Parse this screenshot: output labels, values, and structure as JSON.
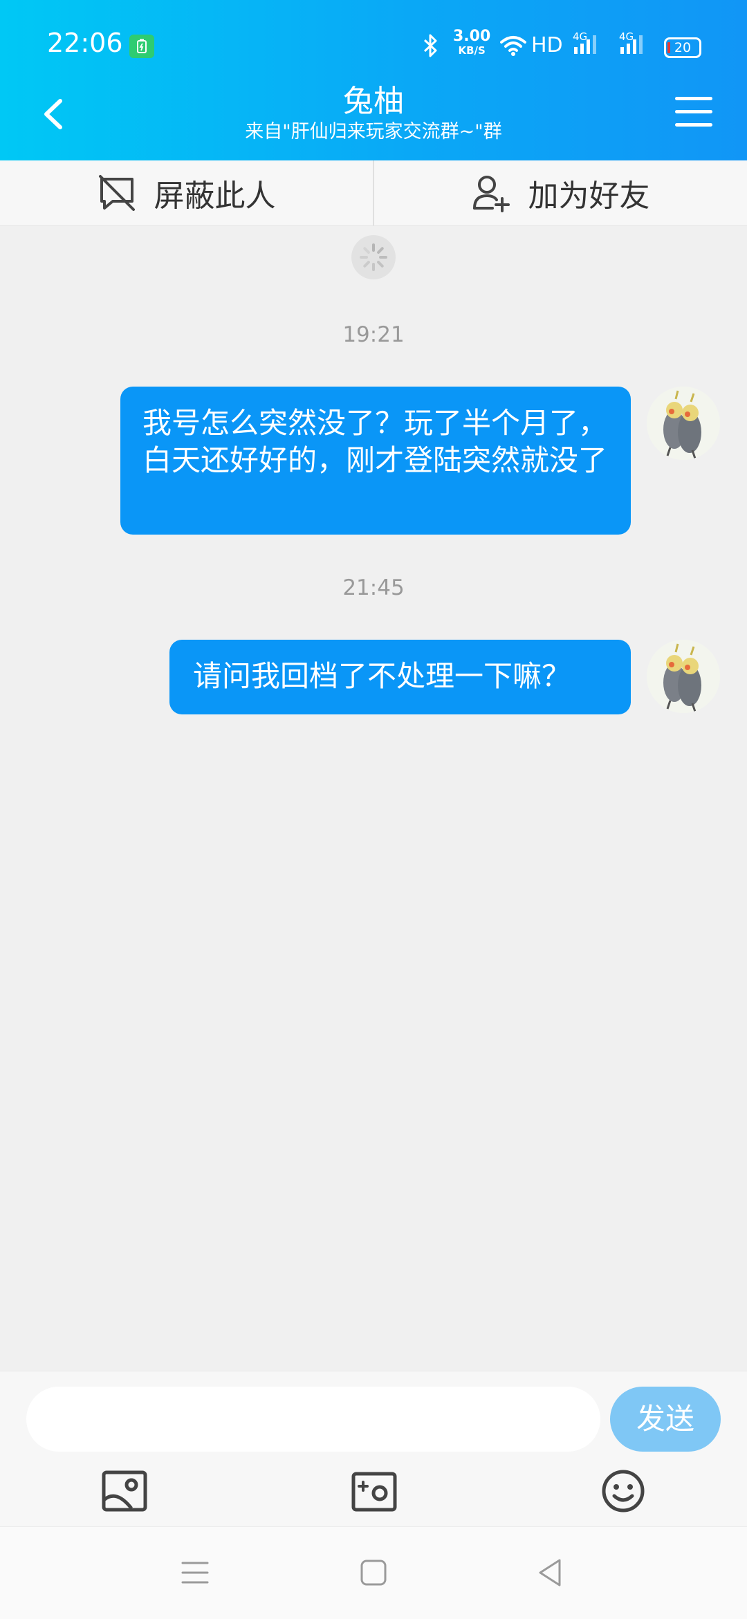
{
  "status_bar": {
    "time": "22:06",
    "net_speed_value": "3.00",
    "net_speed_unit": "KB/S",
    "hd_label": "HD",
    "signal_1": "4G",
    "signal_2": "4G",
    "battery_level": "20"
  },
  "header": {
    "title": "兔柚",
    "subtitle": "来自\"肝仙归来玩家交流群~\"群"
  },
  "actions": {
    "block_label": "屏蔽此人",
    "add_friend_label": "加为好友"
  },
  "messages": [
    {
      "time": "19:21",
      "text": "我号怎么突然没了？玩了半个月了，白天还好好的，刚才登陆突然就没了"
    },
    {
      "time": "21:45",
      "text": "请问我回档了不处理一下嘛？"
    }
  ],
  "input": {
    "placeholder": "",
    "send_label": "发送"
  },
  "colors": {
    "header_gradient_start": "#00c8f5",
    "header_gradient_end": "#1196f6",
    "bubble": "#0a96f7",
    "send_button": "#7fc7f5",
    "background": "#f0f0f0"
  },
  "icons": {
    "back": "chevron-left-icon",
    "menu": "hamburger-menu-icon",
    "block": "block-user-icon",
    "add_friend": "add-user-icon",
    "image": "image-icon",
    "camera": "camera-icon",
    "emoji": "emoji-icon"
  }
}
